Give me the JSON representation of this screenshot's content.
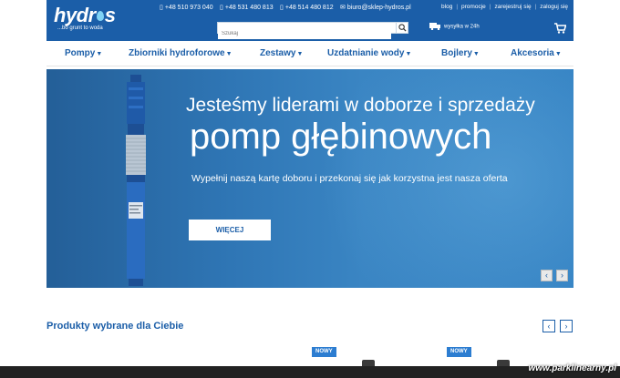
{
  "header": {
    "logo_text_1": "hydr",
    "logo_text_2": "s",
    "tagline": "...bo grunt to woda",
    "phones": [
      "+48 510 973 040",
      "+48 531 480 813",
      "+48 514 480 812"
    ],
    "email": "biuro@sklep-hydros.pl",
    "links": [
      "blog",
      "promocje",
      "zarejestruj się",
      "zaloguj się"
    ],
    "search_placeholder": "Szukaj",
    "shipping": "wysyłka w 24h",
    "icons": {
      "phone": "phone-icon",
      "email": "email-icon",
      "truck": "truck-icon",
      "cart": "cart-icon",
      "search": "search-icon"
    }
  },
  "nav": {
    "items": [
      "Pompy",
      "Zbiorniki hydroforowe",
      "Zestawy",
      "Uzdatnianie wody",
      "Bojlery",
      "Akcesoria"
    ]
  },
  "hero": {
    "line1": "Jesteśmy liderami w doborze i sprzedaży",
    "line2": "pomp głębinowych",
    "line3": "Wypełnij naszą kartę doboru i przekonaj się jak korzystna jest nasza oferta",
    "button": "WIĘCEJ",
    "prev": "‹",
    "next": "›"
  },
  "products": {
    "title": "Produkty wybrane dla Ciebie",
    "prev": "‹",
    "next": "›",
    "badges": [
      "NOWY",
      "NOWY"
    ]
  },
  "watermark": "www.parklinearny.pl",
  "colors": {
    "brand": "#1b5ea8",
    "hero": "#2f76b5",
    "badge": "#2c7dd1"
  }
}
